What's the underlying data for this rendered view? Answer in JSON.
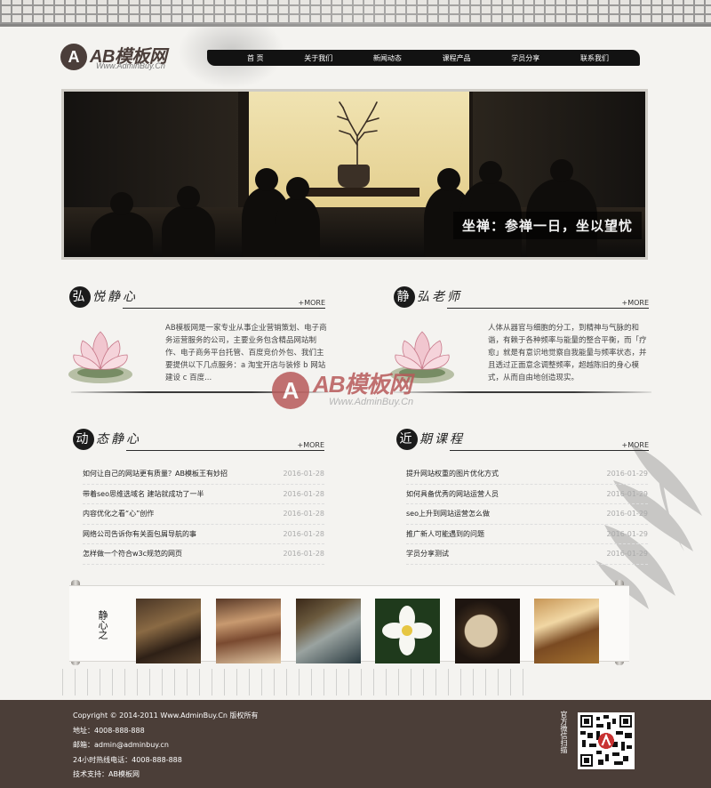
{
  "logo": {
    "mark": "A",
    "name": "AB模板网",
    "url": "Www.AdminBuy.Cn"
  },
  "nav": [
    "首 页",
    "关于我们",
    "新闻动态",
    "课程产品",
    "学员分享",
    "联系我们"
  ],
  "banner": {
    "caption": "坐禅：参禅一日，坐以望忧"
  },
  "sections": {
    "about": {
      "title_blot": "弘",
      "title": "悦静心",
      "more": "+MORE",
      "text": "AB模板网是一家专业从事企业营销策划、电子商务运营服务的公司，主要业务包含精品网站制作、电子商务平台托管、百度竞价外包、我们主要提供以下几点服务：a 淘宝开店与装修 b 网站建设 c 百度..."
    },
    "teacher": {
      "title_blot": "静",
      "title": "弘老师",
      "more": "+MORE",
      "text": "人体从器官与细胞的分工，到精神与气脉的和谐，有赖于各种频率与能量的整合平衡，而「疗愈」就是有意识地觉察自我能量与频率状态，并且透过正面意念调整频率，超越陈旧的身心模式，从而自由地创造现实。"
    },
    "news": {
      "title_blot": "动",
      "title": "态静心",
      "more": "+MORE",
      "items": [
        {
          "title": "如何让自己的网站更有质量？AB模板王有妙招",
          "date": "2016-01-28"
        },
        {
          "title": "带着seo思维选域名 建站就成功了一半",
          "date": "2016-01-28"
        },
        {
          "title": "内容优化之看“心”创作",
          "date": "2016-01-28"
        },
        {
          "title": "网络公司告诉你有关面包屑导航的事",
          "date": "2016-01-28"
        },
        {
          "title": "怎样做一个符合w3c规范的网页",
          "date": "2016-01-28"
        }
      ]
    },
    "courses": {
      "title_blot": "近",
      "title": "期课程",
      "more": "+MORE",
      "items": [
        {
          "title": "提升网站权重的图片优化方式",
          "date": "2016-01-29"
        },
        {
          "title": "如何具备优秀的网站运营人员",
          "date": "2016-01-29"
        },
        {
          "title": "seo上升到网站运营怎么做",
          "date": "2016-01-29"
        },
        {
          "title": "推广新人可能遇到的问题",
          "date": "2016-01-29"
        },
        {
          "title": "学员分享测试",
          "date": "2016-01-29"
        }
      ]
    }
  },
  "gallery": {
    "label": "静心之"
  },
  "watermark": {
    "mark": "A",
    "name": "AB模板网",
    "url": "Www.AdminBuy.Cn"
  },
  "footer": {
    "copyright": "Copyright © 2014-2011 Www.AdminBuy.Cn 版权所有",
    "address": "地址：4008-888-888",
    "email": "邮箱：admin@adminbuy.cn",
    "hotline": "24小时热线电话：4008-888-888",
    "support": "技术支持：AB模板网",
    "qr_label": "官方微信扫描"
  },
  "colors": {
    "footer_bg": "#4b3e38",
    "nav_bg": "#121212",
    "page_bg": "#f4f3f0"
  }
}
